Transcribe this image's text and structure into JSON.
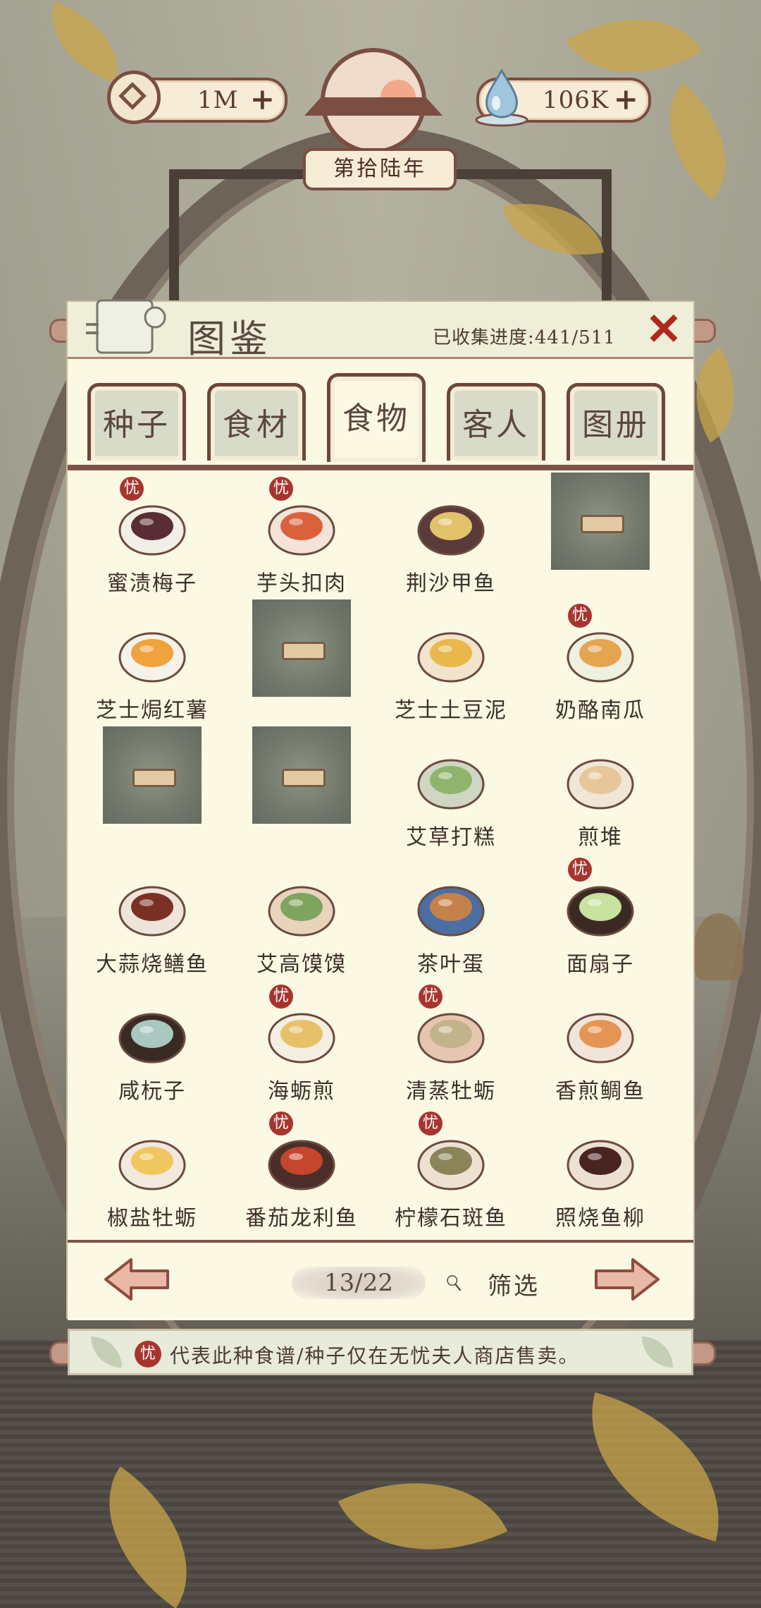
{
  "currency": {
    "coins": "1M",
    "water": "106K",
    "year": "第拾陆年"
  },
  "panel": {
    "title": "图鉴",
    "progress_label": "已收集进度:441/511",
    "close_icon": "x-close-icon"
  },
  "tabs": [
    {
      "label": "种子",
      "active": false
    },
    {
      "label": "食材",
      "active": false
    },
    {
      "label": "食物",
      "active": true
    },
    {
      "label": "客人",
      "active": false
    },
    {
      "label": "图册",
      "active": false
    }
  ],
  "items": [
    {
      "name": "蜜渍梅子",
      "locked": false,
      "shop_only": true
    },
    {
      "name": "芋头扣肉",
      "locked": false,
      "shop_only": true
    },
    {
      "name": "荆沙甲鱼",
      "locked": false,
      "shop_only": false
    },
    {
      "name": "",
      "locked": true,
      "shop_only": false
    },
    {
      "name": "芝士焗红薯",
      "locked": false,
      "shop_only": false
    },
    {
      "name": "",
      "locked": true,
      "shop_only": false
    },
    {
      "name": "芝士土豆泥",
      "locked": false,
      "shop_only": false
    },
    {
      "name": "奶酪南瓜",
      "locked": false,
      "shop_only": true
    },
    {
      "name": "",
      "locked": true,
      "shop_only": false
    },
    {
      "name": "",
      "locked": true,
      "shop_only": false
    },
    {
      "name": "艾草打糕",
      "locked": false,
      "shop_only": false
    },
    {
      "name": "煎堆",
      "locked": false,
      "shop_only": false
    },
    {
      "name": "大蒜烧鳝鱼",
      "locked": false,
      "shop_only": false
    },
    {
      "name": "艾高馍馍",
      "locked": false,
      "shop_only": false
    },
    {
      "name": "茶叶蛋",
      "locked": false,
      "shop_only": false
    },
    {
      "name": "面扇子",
      "locked": false,
      "shop_only": true
    },
    {
      "name": "咸杬子",
      "locked": false,
      "shop_only": false
    },
    {
      "name": "海蛎煎",
      "locked": false,
      "shop_only": true
    },
    {
      "name": "清蒸牡蛎",
      "locked": false,
      "shop_only": true
    },
    {
      "name": "香煎鲷鱼",
      "locked": false,
      "shop_only": false
    },
    {
      "name": "椒盐牡蛎",
      "locked": false,
      "shop_only": false
    },
    {
      "name": "番茄龙利鱼",
      "locked": false,
      "shop_only": true
    },
    {
      "name": "柠檬石斑鱼",
      "locked": false,
      "shop_only": true
    },
    {
      "name": "照烧鱼柳",
      "locked": false,
      "shop_only": false
    }
  ],
  "pager": {
    "page": "13/22",
    "filter_label": "筛选"
  },
  "badge_char": "忧",
  "note": {
    "text": "代表此种食谱/种子仅在无忧夫人商店售卖。"
  },
  "colors": {
    "accent": "#7a4e42",
    "panel_bg": "#fbf8e4",
    "badge": "#a7352e",
    "close": "#b0281e"
  }
}
